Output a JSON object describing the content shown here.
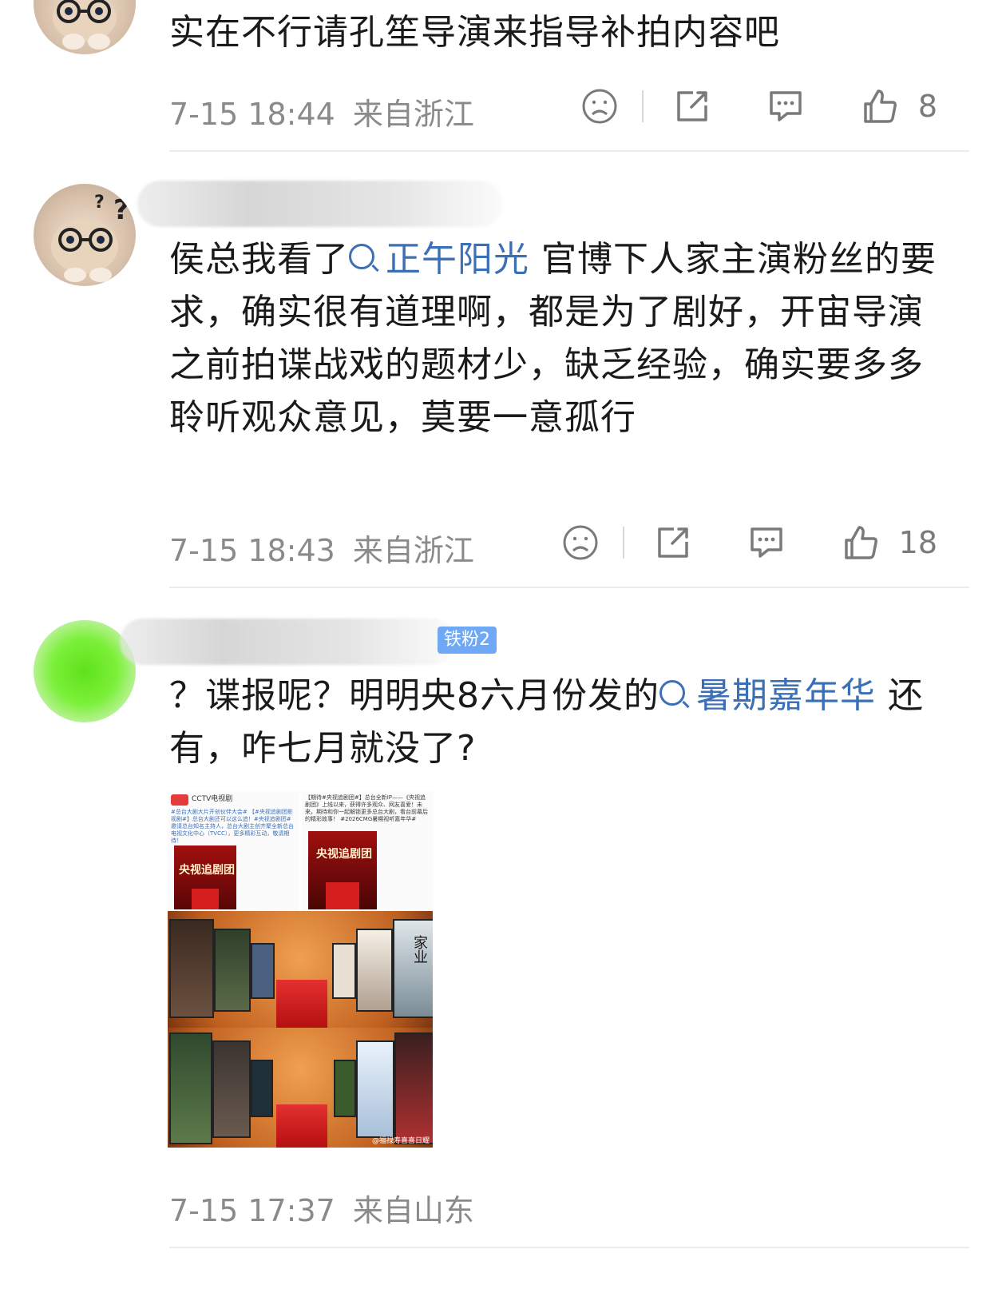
{
  "comments": [
    {
      "text": "实在不行请孔笙导演来指导补拍内容吧",
      "time": "7-15 18:44",
      "location": "来自浙江",
      "likes": "8"
    },
    {
      "text_before": "侯总我看了",
      "topic": "正午阳光",
      "text_after": " 官博下人家主演粉丝的要求，确实很有道理啊，都是为了剧好，开宙导演之前拍谍战戏的题材少，缺乏经验，确实要多多聆听观众意见，莫要一意孤行",
      "time": "7-15 18:43",
      "location": "来自浙江",
      "likes": "18"
    },
    {
      "fan_badge": "铁粉2",
      "text_before": "？谍报呢？明明央8六月份发的",
      "topic": "暑期嘉年华",
      "text_after": " 还有，咋七月就没了?",
      "time": "7-15 17:37",
      "location": "来自山东",
      "image": {
        "post1_author": "CCTV电视剧",
        "post1_text": "#总台大剧大片开创伙伴大会# 【#央视追剧团影视剧#】总台大剧还可以这么追！#央视追剧团# 邀请总台知名主持人，总台大剧主创齐聚全新总台电视文化中心（TVCC），更多精彩互动，敬请期待！",
        "post2_text": "【期待#央视追剧团#】总台全新IP——《央视追剧团》上线以来，获得许多观众、网友喜爱！未来，期待和你一起解锁更多总台大剧，看台前幕后的精彩故事！ #2026CMG暑期视听嘉年华#",
        "stage_label": "央视追剧团",
        "poster_title_1": "家业",
        "watermark": "@福禄寿喜喜日耀"
      }
    }
  ],
  "icons": {
    "dislike": "dislike-face-icon",
    "share": "share-icon",
    "comment": "comment-icon",
    "like": "thumbs-up-icon"
  },
  "colors": {
    "topic": "#3b6fb6",
    "meta": "#8a8a8a",
    "icon": "#7a7a7a"
  }
}
